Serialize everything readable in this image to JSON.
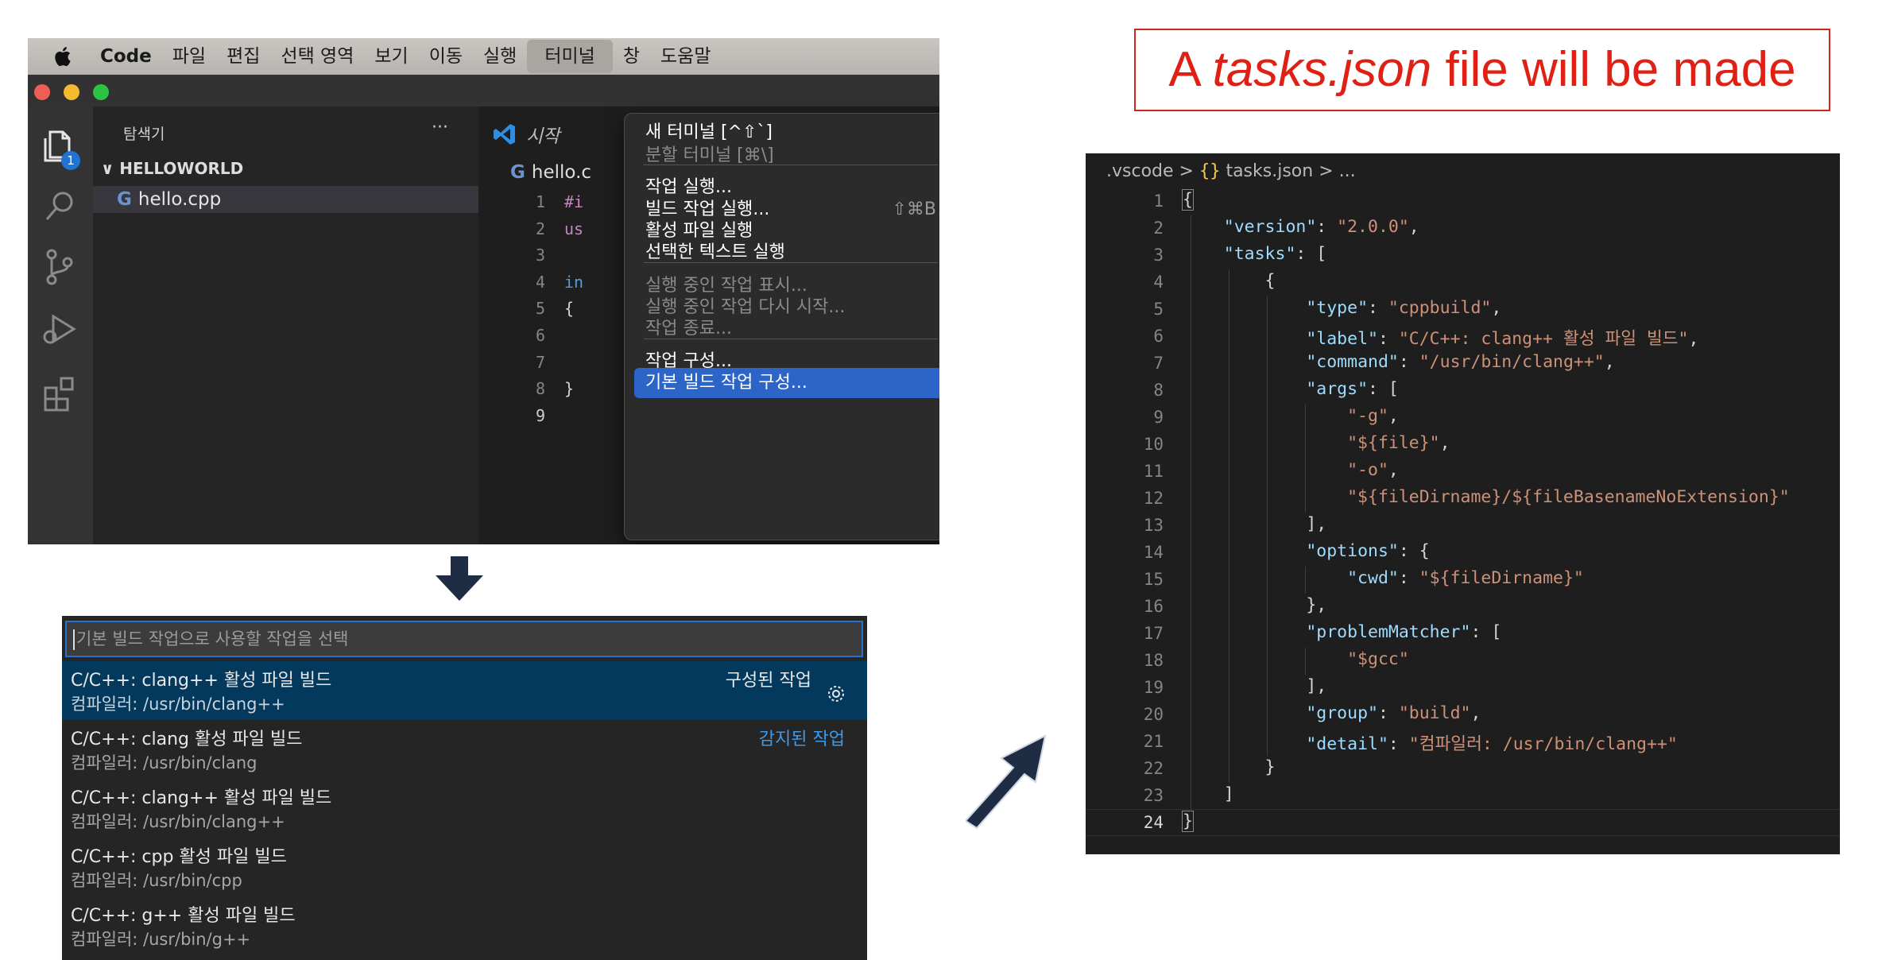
{
  "mac_menubar": {
    "apple": "apple-logo-icon",
    "items": [
      "Code",
      "파일",
      "편집",
      "선택 영역",
      "보기",
      "이동",
      "실행",
      "터미널",
      "창",
      "도움말"
    ]
  },
  "explorer": {
    "title": "탐색기",
    "more": "···",
    "folder": "HELLOWORLD",
    "file": "hello.cpp",
    "badge": "1"
  },
  "editor": {
    "welcome_tab": "시작",
    "file_tab": "hello.c",
    "line_numbers": [
      "1",
      "2",
      "3",
      "4",
      "5",
      "6",
      "7",
      "8",
      "9"
    ],
    "code_fragments": [
      "#i",
      "us",
      "",
      "in",
      "{",
      "",
      "",
      "}",
      ""
    ]
  },
  "terminal_menu": {
    "items": [
      {
        "label": "새 터미널 [^⇧`]",
        "shortcut": "",
        "disabled": false
      },
      {
        "label": "분할 터미널 [⌘\\]",
        "shortcut": "",
        "disabled": true
      },
      {
        "label": "작업 실행...",
        "shortcut": "",
        "disabled": false
      },
      {
        "label": "빌드 작업 실행...",
        "shortcut": "⇧⌘B",
        "disabled": false
      },
      {
        "label": "활성 파일 실행",
        "shortcut": "",
        "disabled": false
      },
      {
        "label": "선택한 텍스트 실행",
        "shortcut": "",
        "disabled": false
      },
      {
        "label": "실행 중인 작업 표시...",
        "shortcut": "",
        "disabled": true
      },
      {
        "label": "실행 중인 작업 다시 시작...",
        "shortcut": "",
        "disabled": true
      },
      {
        "label": "작업 종료...",
        "shortcut": "",
        "disabled": true
      },
      {
        "label": "작업 구성...",
        "shortcut": "",
        "disabled": false
      },
      {
        "label": "기본 빌드 작업 구성...",
        "shortcut": "",
        "disabled": false,
        "selected": true
      }
    ]
  },
  "quick_pick": {
    "placeholder": "기본 빌드 작업으로 사용할 작업을 선택",
    "items": [
      {
        "title": "C/C++: clang++ 활성 파일 빌드",
        "detail": "컴파일러: /usr/bin/clang++",
        "tag": "구성된 작업",
        "active": true
      },
      {
        "title": "C/C++: clang 활성 파일 빌드",
        "detail": "컴파일러: /usr/bin/clang",
        "tag": "감지된 작업"
      },
      {
        "title": "C/C++: clang++ 활성 파일 빌드",
        "detail": "컴파일러: /usr/bin/clang++",
        "tag": ""
      },
      {
        "title": "C/C++: cpp 활성 파일 빌드",
        "detail": "컴파일러: /usr/bin/cpp",
        "tag": ""
      },
      {
        "title": "C/C++: g++ 활성 파일 빌드",
        "detail": "컴파일러: /usr/bin/g++",
        "tag": ""
      }
    ]
  },
  "caption": {
    "prefix": "A ",
    "emphasis": "tasks.json",
    "suffix": " file will be made"
  },
  "tasks_json": {
    "breadcrumb": {
      "folder": ".vscode",
      "sep1": " > ",
      "icon": "{}",
      "file": "tasks.json",
      "sep2": " > ",
      "tail": "..."
    },
    "lines": [
      [
        [
          "p",
          "{"
        ]
      ],
      [
        [
          "p",
          "    "
        ],
        [
          "k",
          "\"version\""
        ],
        [
          "p",
          ": "
        ],
        [
          "s",
          "\"2.0.0\""
        ],
        [
          "p",
          ","
        ]
      ],
      [
        [
          "p",
          "    "
        ],
        [
          "k",
          "\"tasks\""
        ],
        [
          "p",
          ": ["
        ]
      ],
      [
        [
          "p",
          "        {"
        ]
      ],
      [
        [
          "p",
          "            "
        ],
        [
          "k",
          "\"type\""
        ],
        [
          "p",
          ": "
        ],
        [
          "s",
          "\"cppbuild\""
        ],
        [
          "p",
          ","
        ]
      ],
      [
        [
          "p",
          "            "
        ],
        [
          "k",
          "\"label\""
        ],
        [
          "p",
          ": "
        ],
        [
          "s",
          "\"C/C++: clang++ 활성 파일 빌드\""
        ],
        [
          "p",
          ","
        ]
      ],
      [
        [
          "p",
          "            "
        ],
        [
          "k",
          "\"command\""
        ],
        [
          "p",
          ": "
        ],
        [
          "s",
          "\"/usr/bin/clang++\""
        ],
        [
          "p",
          ","
        ]
      ],
      [
        [
          "p",
          "            "
        ],
        [
          "k",
          "\"args\""
        ],
        [
          "p",
          ": ["
        ]
      ],
      [
        [
          "p",
          "                "
        ],
        [
          "s",
          "\"-g\""
        ],
        [
          "p",
          ","
        ]
      ],
      [
        [
          "p",
          "                "
        ],
        [
          "s",
          "\"${file}\""
        ],
        [
          "p",
          ","
        ]
      ],
      [
        [
          "p",
          "                "
        ],
        [
          "s",
          "\"-o\""
        ],
        [
          "p",
          ","
        ]
      ],
      [
        [
          "p",
          "                "
        ],
        [
          "s",
          "\"${fileDirname}/${fileBasenameNoExtension}\""
        ]
      ],
      [
        [
          "p",
          "            ],"
        ]
      ],
      [
        [
          "p",
          "            "
        ],
        [
          "k",
          "\"options\""
        ],
        [
          "p",
          ": {"
        ]
      ],
      [
        [
          "p",
          "                "
        ],
        [
          "k",
          "\"cwd\""
        ],
        [
          "p",
          ": "
        ],
        [
          "s",
          "\"${fileDirname}\""
        ]
      ],
      [
        [
          "p",
          "            },"
        ]
      ],
      [
        [
          "p",
          "            "
        ],
        [
          "k",
          "\"problemMatcher\""
        ],
        [
          "p",
          ": ["
        ]
      ],
      [
        [
          "p",
          "                "
        ],
        [
          "s",
          "\"$gcc\""
        ]
      ],
      [
        [
          "p",
          "            ],"
        ]
      ],
      [
        [
          "p",
          "            "
        ],
        [
          "k",
          "\"group\""
        ],
        [
          "p",
          ": "
        ],
        [
          "s",
          "\"build\""
        ],
        [
          "p",
          ","
        ]
      ],
      [
        [
          "p",
          "            "
        ],
        [
          "k",
          "\"detail\""
        ],
        [
          "p",
          ": "
        ],
        [
          "s",
          "\"컴파일러: /usr/bin/clang++\""
        ]
      ],
      [
        [
          "p",
          "        }"
        ]
      ],
      [
        [
          "p",
          "    ]"
        ]
      ],
      [
        [
          "p",
          "}"
        ]
      ]
    ]
  },
  "colors": {
    "accent_blue": "#2d64c8",
    "caption_red": "#e02015",
    "json_key": "#9cdcfe",
    "json_string": "#ce9178",
    "arrow_navy": "#1f2d44"
  }
}
